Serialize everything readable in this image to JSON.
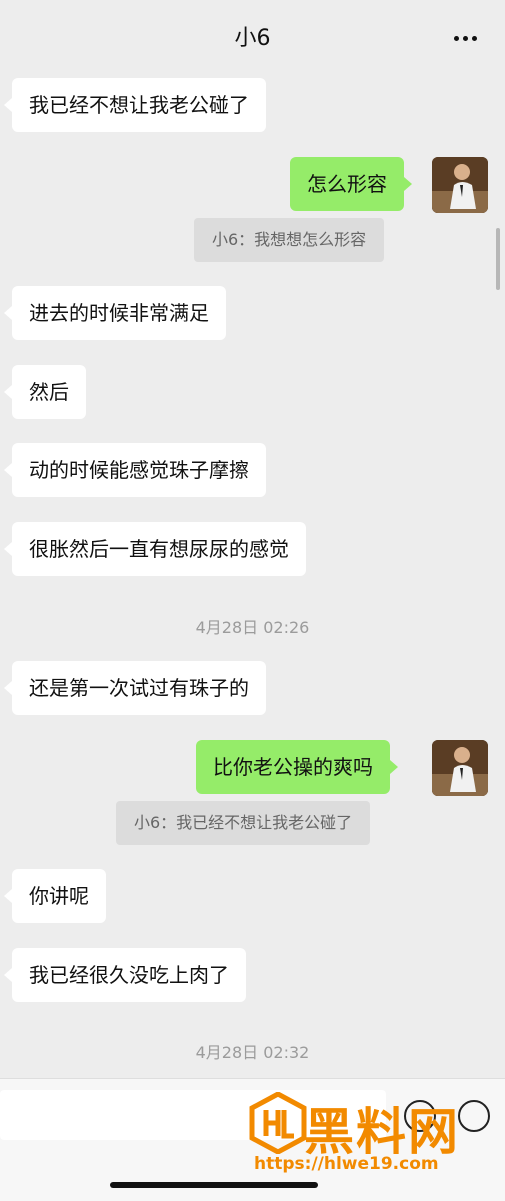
{
  "header": {
    "title": "小6"
  },
  "messages": [
    {
      "dir": "in",
      "text": "我已经不想让我老公碰了"
    },
    {
      "dir": "out",
      "text": "怎么形容",
      "quote": "小6：我想想怎么形容"
    },
    {
      "dir": "in",
      "text": "进去的时候非常满足"
    },
    {
      "dir": "in",
      "text": "然后"
    },
    {
      "dir": "in",
      "text": "动的时候能感觉珠子摩擦"
    },
    {
      "dir": "in",
      "text": "很胀然后一直有想尿尿的感觉"
    },
    {
      "time": "4月28日 02:26"
    },
    {
      "dir": "in",
      "text": "还是第一次试过有珠子的"
    },
    {
      "dir": "out",
      "text": "比你老公操的爽吗",
      "quote": "小6：我已经不想让我老公碰了"
    },
    {
      "dir": "in",
      "text": "你讲呢"
    },
    {
      "dir": "in",
      "text": "我已经很久没吃上肉了"
    },
    {
      "time": "4月28日 02:32"
    }
  ],
  "watermark": {
    "text": "黑料网",
    "url": "https://hlwe19.com"
  },
  "colors": {
    "background": "#ededed",
    "bubble_out": "#95ec69",
    "bubble_in": "#ffffff",
    "accent": "#f28a00"
  }
}
